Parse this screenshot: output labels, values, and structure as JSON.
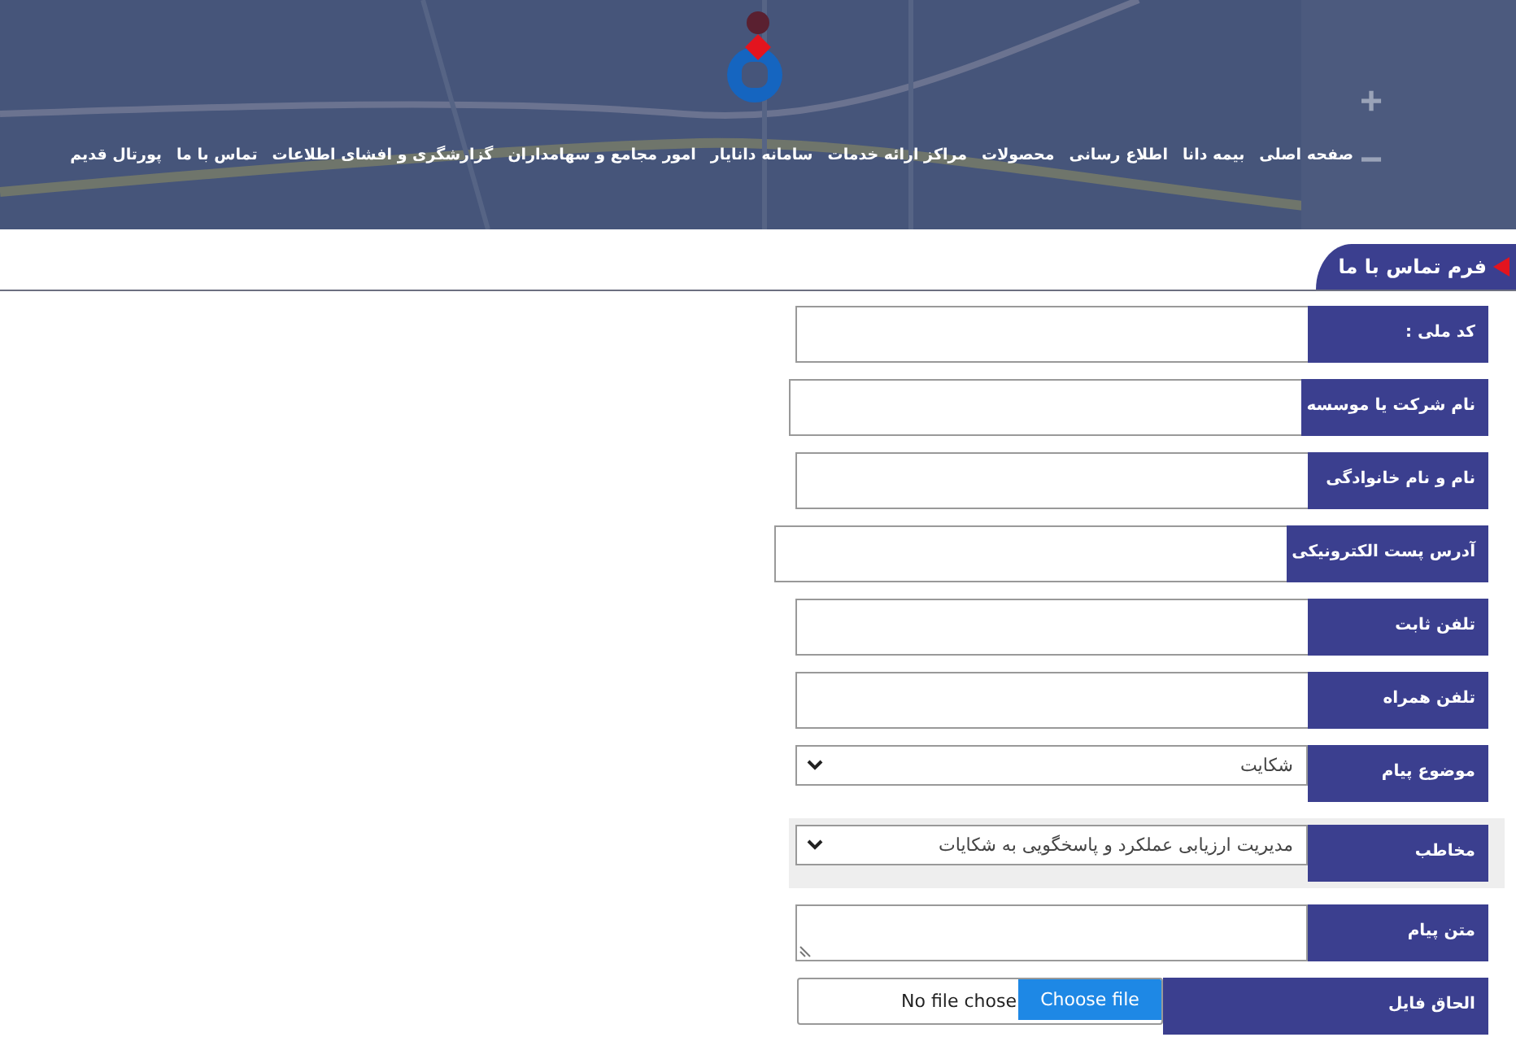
{
  "map": {
    "zoom_controls": [
      "+",
      "−"
    ]
  },
  "nav": [
    "صفحه اصلی",
    "بیمه دانا",
    "اطلاع رسانی",
    "محصولات",
    "مراکز ارائه خدمات",
    "سامانه دانایار",
    "امور مجامع و سهامداران",
    "گزارشگری و افشای اطلاعات",
    "تماس با ما",
    "پورتال قدیم"
  ],
  "form": {
    "title": "فرم تماس با ما",
    "fields": [
      {
        "kind": "text",
        "label": "کد ملی :",
        "highlighted": false
      },
      {
        "kind": "text",
        "label": "نام شرکت یا موسسه",
        "highlighted": false
      },
      {
        "kind": "text",
        "label": "نام و نام خانوادگی",
        "highlighted": false
      },
      {
        "kind": "text",
        "label": "آدرس پست الکترونیکی",
        "highlighted": false
      },
      {
        "kind": "text",
        "label": "تلفن ثابت",
        "highlighted": false
      },
      {
        "kind": "text",
        "label": "تلفن همراه",
        "highlighted": false
      },
      {
        "kind": "select",
        "label": "موضوع پیام",
        "value": "شکایت",
        "highlighted": false
      },
      {
        "kind": "select",
        "label": "مخاطب",
        "value": "مدیریت ارزیابی عملکرد و پاسخگویی به شکایات",
        "highlighted": true
      },
      {
        "kind": "textarea",
        "label": "متن پیام",
        "highlighted": false
      },
      {
        "kind": "file",
        "label": "الحاق فایل",
        "button": "Choose file",
        "status": "No file chose",
        "highlighted": false
      }
    ]
  }
}
